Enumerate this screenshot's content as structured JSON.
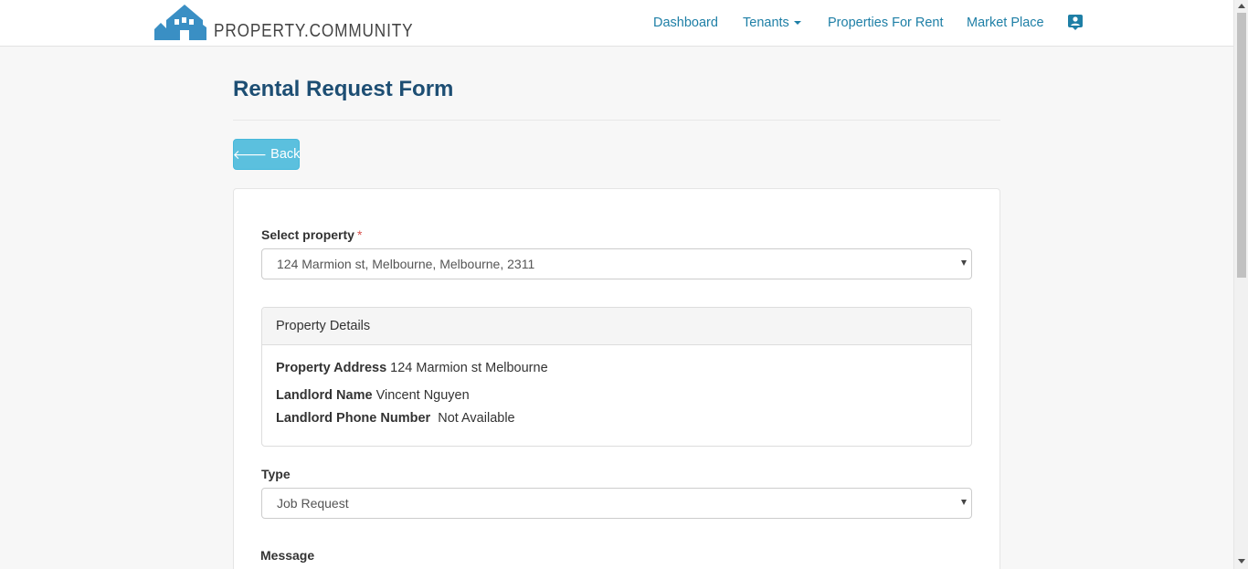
{
  "brand": {
    "name": "PROPERTY.COMMUNITY"
  },
  "nav": {
    "dashboard": "Dashboard",
    "tenants": "Tenants",
    "properties_for_rent": "Properties For Rent",
    "market_place": "Market Place",
    "profile_icon": "contact-card-icon"
  },
  "page": {
    "title": "Rental Request Form",
    "back_label": "Back"
  },
  "form": {
    "property_label": "Select property",
    "required_mark": "*",
    "property_value": "124 Marmion st, Melbourne, Melbourne, 2311",
    "type_label": "Type",
    "type_value": "Job Request",
    "message_label": "Message"
  },
  "details": {
    "heading": "Property Details",
    "address_label": "Property Address",
    "address_value": "124 Marmion st Melbourne",
    "landlord_label": "Landlord Name",
    "landlord_value": "Vincent Nguyen",
    "phone_label": "Landlord Phone Number",
    "phone_value": "Not Available"
  },
  "colors": {
    "accent": "#1e7fa6",
    "title": "#1d4e73",
    "back_button": "#5bc0de",
    "logo": "#3a8fc4"
  }
}
